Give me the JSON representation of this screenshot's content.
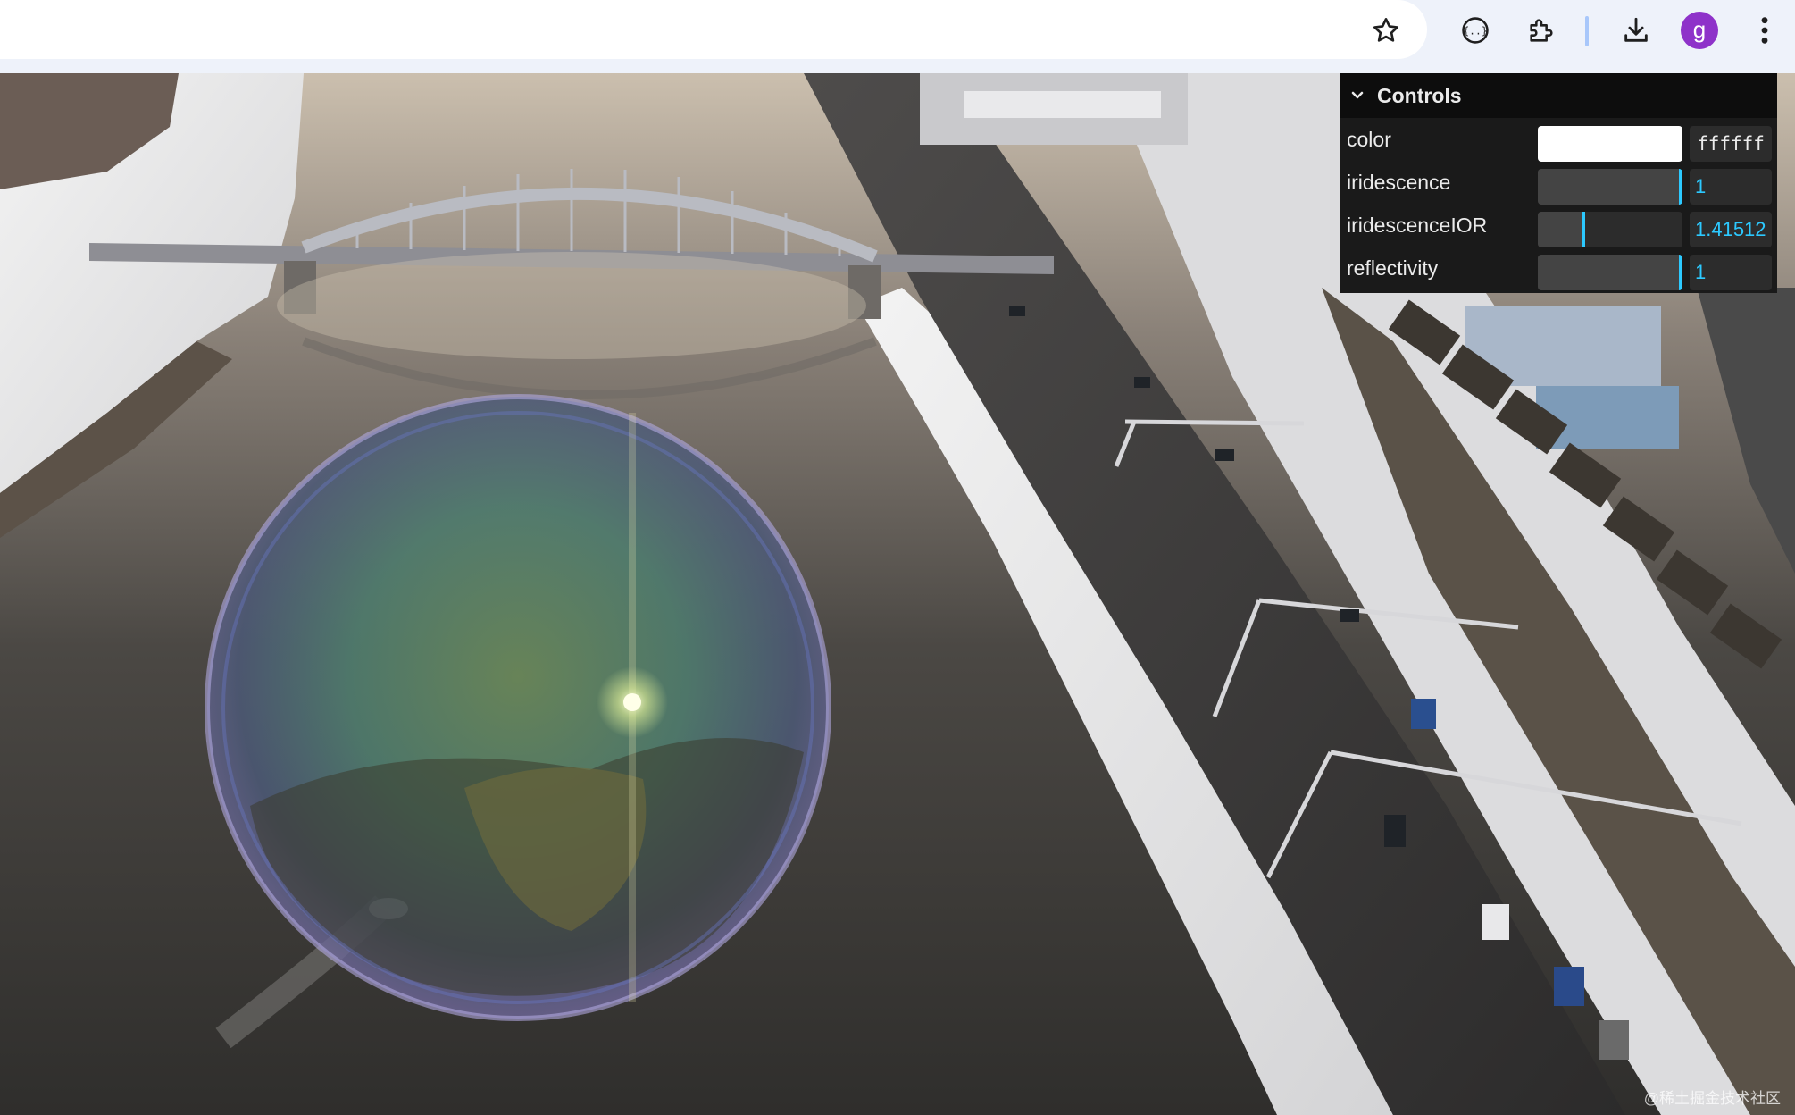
{
  "toolbar": {
    "icons": [
      "bookmark-star-icon",
      "developer-tools-icon",
      "extensions-icon",
      "download-icon",
      "more-menu-icon"
    ],
    "avatar_letter": "g",
    "avatar_color": "#8e32c9"
  },
  "controls": {
    "title": "Controls",
    "rows": [
      {
        "label": "color",
        "type": "color",
        "value": "ffffff",
        "swatch": "#ffffff"
      },
      {
        "label": "iridescence",
        "type": "slider",
        "value": "1",
        "fraction": 1.0
      },
      {
        "label": "iridescenceIOR",
        "type": "slider",
        "value": "1.41512",
        "fraction": 0.31
      },
      {
        "label": "reflectivity",
        "type": "slider",
        "value": "1",
        "fraction": 1.0
      }
    ],
    "accent_color": "#2cc9ff"
  },
  "watermark": "@稀土掘金技术社区"
}
